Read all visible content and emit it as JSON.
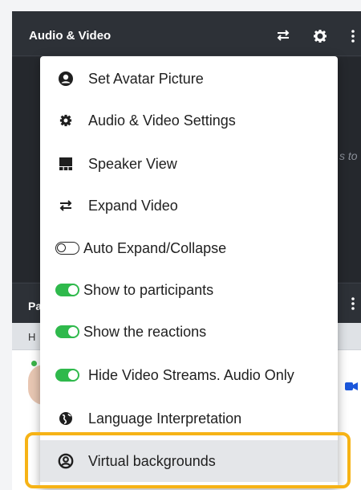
{
  "audio_video_panel": {
    "title": "Audio & Video",
    "icons": [
      "swap-icon",
      "gear-icon",
      "more-icon"
    ],
    "faded_text": "s to"
  },
  "participants_panel": {
    "title_fragment": "Pa",
    "sub_fragment": "H"
  },
  "menu": {
    "items": [
      {
        "label": "Set Avatar Picture",
        "icon": "user-circle-icon"
      },
      {
        "label": "Audio & Video Settings",
        "icon": "gear-icon"
      },
      {
        "label": "Speaker View",
        "icon": "speaker-view-icon"
      },
      {
        "label": "Expand Video",
        "icon": "swap-icon"
      },
      {
        "label": "Auto Expand/Collapse",
        "icon": "toggle-off-icon",
        "toggle": "off"
      },
      {
        "label": "Show to participants",
        "icon": "toggle-on-icon",
        "toggle": "on"
      },
      {
        "label": "Show the reactions",
        "icon": "toggle-on-icon",
        "toggle": "on"
      },
      {
        "label": "Hide Video Streams. Audio Only",
        "icon": "toggle-on-icon",
        "toggle": "on"
      },
      {
        "label": "Language Interpretation",
        "icon": "globe-icon"
      },
      {
        "label": "Virtual backgrounds",
        "icon": "user-circle-outline-icon",
        "selected": true
      }
    ]
  },
  "colors": {
    "toggle_on": "#2fb94c",
    "highlight": "#f6b316",
    "header_bg": "#2d3137"
  }
}
